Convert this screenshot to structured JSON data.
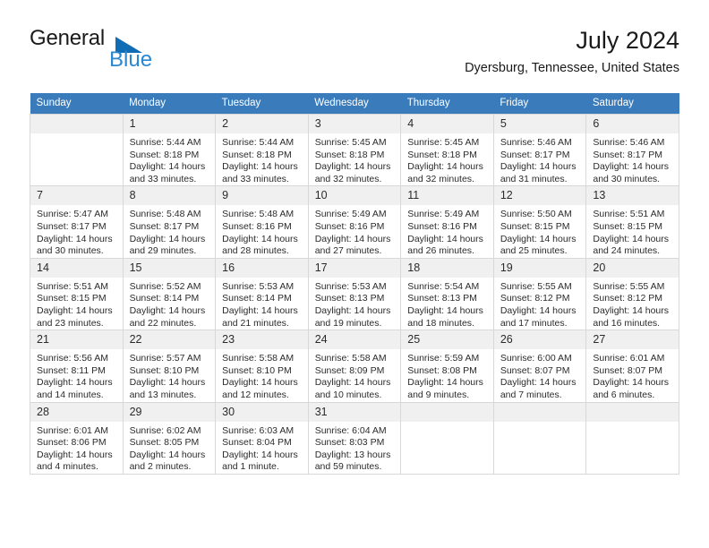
{
  "brand": {
    "word_one": "General",
    "word_two": "Blue",
    "triangle_color": "#0f6cb5",
    "blue_color": "#2a87d0"
  },
  "header": {
    "title": "July 2024",
    "subtitle": "Dyersburg, Tennessee, United States",
    "header_bg": "#3a7cbb"
  },
  "calendar": {
    "weekdays": [
      "Sunday",
      "Monday",
      "Tuesday",
      "Wednesday",
      "Thursday",
      "Friday",
      "Saturday"
    ],
    "leading_blanks": 1,
    "weeks": [
      [
        null,
        {
          "day": "1",
          "sunrise": "Sunrise: 5:44 AM",
          "sunset": "Sunset: 8:18 PM",
          "daylight_line1": "Daylight: 14 hours",
          "daylight_line2": "and 33 minutes."
        },
        {
          "day": "2",
          "sunrise": "Sunrise: 5:44 AM",
          "sunset": "Sunset: 8:18 PM",
          "daylight_line1": "Daylight: 14 hours",
          "daylight_line2": "and 33 minutes."
        },
        {
          "day": "3",
          "sunrise": "Sunrise: 5:45 AM",
          "sunset": "Sunset: 8:18 PM",
          "daylight_line1": "Daylight: 14 hours",
          "daylight_line2": "and 32 minutes."
        },
        {
          "day": "4",
          "sunrise": "Sunrise: 5:45 AM",
          "sunset": "Sunset: 8:18 PM",
          "daylight_line1": "Daylight: 14 hours",
          "daylight_line2": "and 32 minutes."
        },
        {
          "day": "5",
          "sunrise": "Sunrise: 5:46 AM",
          "sunset": "Sunset: 8:17 PM",
          "daylight_line1": "Daylight: 14 hours",
          "daylight_line2": "and 31 minutes."
        },
        {
          "day": "6",
          "sunrise": "Sunrise: 5:46 AM",
          "sunset": "Sunset: 8:17 PM",
          "daylight_line1": "Daylight: 14 hours",
          "daylight_line2": "and 30 minutes."
        }
      ],
      [
        {
          "day": "7",
          "sunrise": "Sunrise: 5:47 AM",
          "sunset": "Sunset: 8:17 PM",
          "daylight_line1": "Daylight: 14 hours",
          "daylight_line2": "and 30 minutes."
        },
        {
          "day": "8",
          "sunrise": "Sunrise: 5:48 AM",
          "sunset": "Sunset: 8:17 PM",
          "daylight_line1": "Daylight: 14 hours",
          "daylight_line2": "and 29 minutes."
        },
        {
          "day": "9",
          "sunrise": "Sunrise: 5:48 AM",
          "sunset": "Sunset: 8:16 PM",
          "daylight_line1": "Daylight: 14 hours",
          "daylight_line2": "and 28 minutes."
        },
        {
          "day": "10",
          "sunrise": "Sunrise: 5:49 AM",
          "sunset": "Sunset: 8:16 PM",
          "daylight_line1": "Daylight: 14 hours",
          "daylight_line2": "and 27 minutes."
        },
        {
          "day": "11",
          "sunrise": "Sunrise: 5:49 AM",
          "sunset": "Sunset: 8:16 PM",
          "daylight_line1": "Daylight: 14 hours",
          "daylight_line2": "and 26 minutes."
        },
        {
          "day": "12",
          "sunrise": "Sunrise: 5:50 AM",
          "sunset": "Sunset: 8:15 PM",
          "daylight_line1": "Daylight: 14 hours",
          "daylight_line2": "and 25 minutes."
        },
        {
          "day": "13",
          "sunrise": "Sunrise: 5:51 AM",
          "sunset": "Sunset: 8:15 PM",
          "daylight_line1": "Daylight: 14 hours",
          "daylight_line2": "and 24 minutes."
        }
      ],
      [
        {
          "day": "14",
          "sunrise": "Sunrise: 5:51 AM",
          "sunset": "Sunset: 8:15 PM",
          "daylight_line1": "Daylight: 14 hours",
          "daylight_line2": "and 23 minutes."
        },
        {
          "day": "15",
          "sunrise": "Sunrise: 5:52 AM",
          "sunset": "Sunset: 8:14 PM",
          "daylight_line1": "Daylight: 14 hours",
          "daylight_line2": "and 22 minutes."
        },
        {
          "day": "16",
          "sunrise": "Sunrise: 5:53 AM",
          "sunset": "Sunset: 8:14 PM",
          "daylight_line1": "Daylight: 14 hours",
          "daylight_line2": "and 21 minutes."
        },
        {
          "day": "17",
          "sunrise": "Sunrise: 5:53 AM",
          "sunset": "Sunset: 8:13 PM",
          "daylight_line1": "Daylight: 14 hours",
          "daylight_line2": "and 19 minutes."
        },
        {
          "day": "18",
          "sunrise": "Sunrise: 5:54 AM",
          "sunset": "Sunset: 8:13 PM",
          "daylight_line1": "Daylight: 14 hours",
          "daylight_line2": "and 18 minutes."
        },
        {
          "day": "19",
          "sunrise": "Sunrise: 5:55 AM",
          "sunset": "Sunset: 8:12 PM",
          "daylight_line1": "Daylight: 14 hours",
          "daylight_line2": "and 17 minutes."
        },
        {
          "day": "20",
          "sunrise": "Sunrise: 5:55 AM",
          "sunset": "Sunset: 8:12 PM",
          "daylight_line1": "Daylight: 14 hours",
          "daylight_line2": "and 16 minutes."
        }
      ],
      [
        {
          "day": "21",
          "sunrise": "Sunrise: 5:56 AM",
          "sunset": "Sunset: 8:11 PM",
          "daylight_line1": "Daylight: 14 hours",
          "daylight_line2": "and 14 minutes."
        },
        {
          "day": "22",
          "sunrise": "Sunrise: 5:57 AM",
          "sunset": "Sunset: 8:10 PM",
          "daylight_line1": "Daylight: 14 hours",
          "daylight_line2": "and 13 minutes."
        },
        {
          "day": "23",
          "sunrise": "Sunrise: 5:58 AM",
          "sunset": "Sunset: 8:10 PM",
          "daylight_line1": "Daylight: 14 hours",
          "daylight_line2": "and 12 minutes."
        },
        {
          "day": "24",
          "sunrise": "Sunrise: 5:58 AM",
          "sunset": "Sunset: 8:09 PM",
          "daylight_line1": "Daylight: 14 hours",
          "daylight_line2": "and 10 minutes."
        },
        {
          "day": "25",
          "sunrise": "Sunrise: 5:59 AM",
          "sunset": "Sunset: 8:08 PM",
          "daylight_line1": "Daylight: 14 hours",
          "daylight_line2": "and 9 minutes."
        },
        {
          "day": "26",
          "sunrise": "Sunrise: 6:00 AM",
          "sunset": "Sunset: 8:07 PM",
          "daylight_line1": "Daylight: 14 hours",
          "daylight_line2": "and 7 minutes."
        },
        {
          "day": "27",
          "sunrise": "Sunrise: 6:01 AM",
          "sunset": "Sunset: 8:07 PM",
          "daylight_line1": "Daylight: 14 hours",
          "daylight_line2": "and 6 minutes."
        }
      ],
      [
        {
          "day": "28",
          "sunrise": "Sunrise: 6:01 AM",
          "sunset": "Sunset: 8:06 PM",
          "daylight_line1": "Daylight: 14 hours",
          "daylight_line2": "and 4 minutes."
        },
        {
          "day": "29",
          "sunrise": "Sunrise: 6:02 AM",
          "sunset": "Sunset: 8:05 PM",
          "daylight_line1": "Daylight: 14 hours",
          "daylight_line2": "and 2 minutes."
        },
        {
          "day": "30",
          "sunrise": "Sunrise: 6:03 AM",
          "sunset": "Sunset: 8:04 PM",
          "daylight_line1": "Daylight: 14 hours",
          "daylight_line2": "and 1 minute."
        },
        {
          "day": "31",
          "sunrise": "Sunrise: 6:04 AM",
          "sunset": "Sunset: 8:03 PM",
          "daylight_line1": "Daylight: 13 hours",
          "daylight_line2": "and 59 minutes."
        },
        null,
        null,
        null
      ]
    ]
  }
}
